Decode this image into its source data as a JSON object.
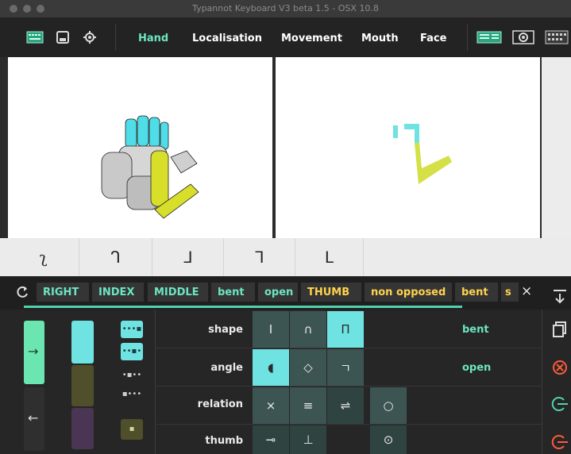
{
  "window": {
    "title": "Typannot Keyboard V3 beta 1.5 - OSX 10.8"
  },
  "toolbar": {
    "tabs": [
      "Hand",
      "Localisation",
      "Movement",
      "Mouth",
      "Face"
    ],
    "active_tab": "Hand",
    "icons": [
      "keyboard-icon",
      "save-icon",
      "gear-icon",
      "table-layout-icon",
      "camera-icon",
      "grid-view-icon"
    ]
  },
  "glyph_row": {
    "glyphs": [
      "ʅ",
      "ᒉ",
      "ᒧ",
      "ᒣ",
      "ᒪ"
    ]
  },
  "tag_bar": {
    "refresh_icon": "refresh-icon",
    "tags": [
      "RIGHT",
      "INDEX",
      "MIDDLE",
      "bent",
      "open",
      "THUMB",
      "non opposed",
      "bent",
      "s"
    ],
    "clear_label": "×"
  },
  "panel": {
    "rows": [
      {
        "label": "shape",
        "buttons": [
          "I",
          "∩",
          "Π"
        ],
        "selected": 2,
        "value": "bent"
      },
      {
        "label": "angle",
        "buttons": [
          "◖",
          "◇",
          "ㄱ"
        ],
        "selected": 0,
        "value": "open"
      },
      {
        "label": "relation",
        "buttons": [
          "×",
          "≡",
          "⇌",
          "○"
        ],
        "selected": -1,
        "value": ""
      },
      {
        "label": "thumb",
        "buttons": [
          "⊸",
          "⊥",
          "",
          "⊙"
        ],
        "selected": -1,
        "value": ""
      }
    ],
    "side_actions": [
      "collapse-icon",
      "copy-icon",
      "cancel-icon",
      "exit-icon",
      "exit-all-icon"
    ]
  },
  "colors": {
    "accent": "#6be6c2",
    "cyan": "#6fe2e2",
    "yellow": "#ffd34d",
    "olive": "#4f4f2c",
    "purple": "#4a3552",
    "button_teal": "#3d5552"
  }
}
